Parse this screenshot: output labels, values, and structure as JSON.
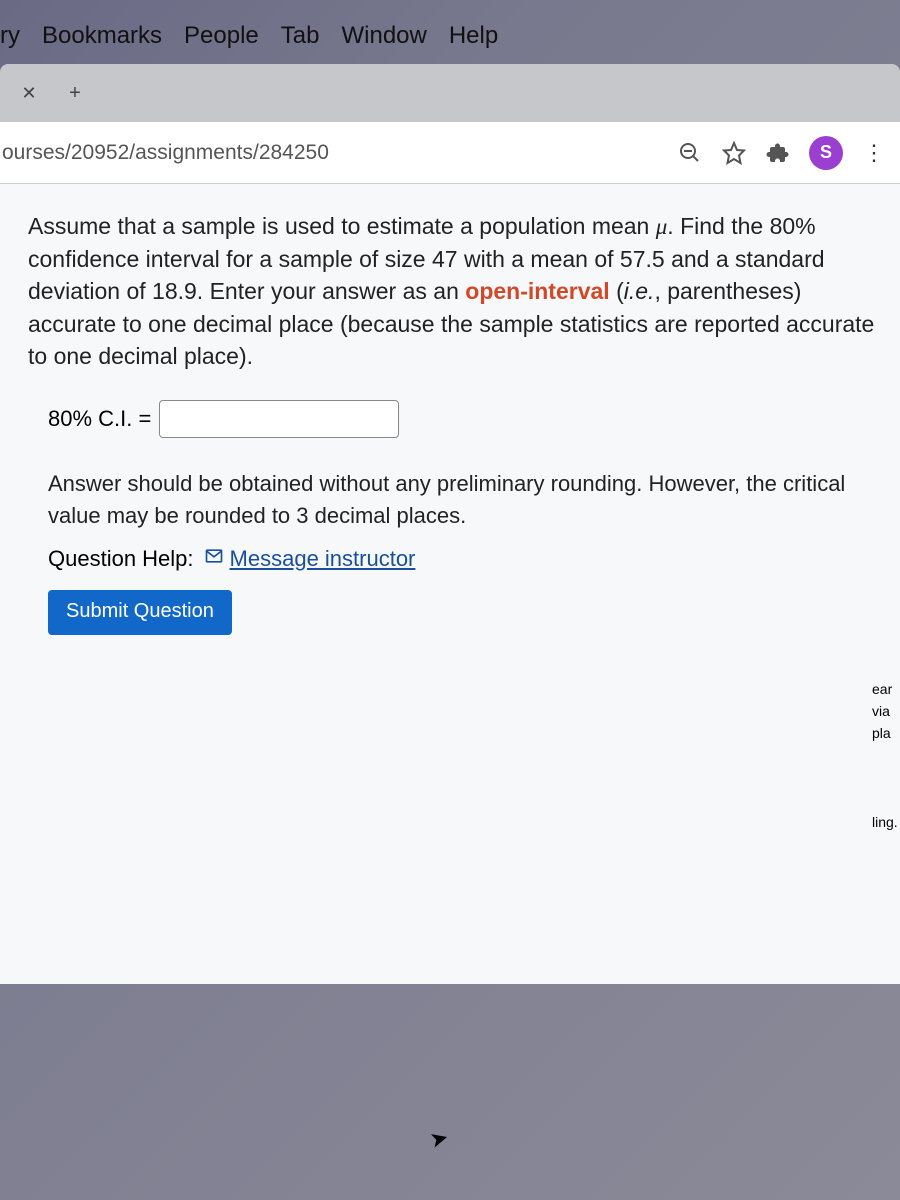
{
  "menubar": {
    "items": [
      "ry",
      "Bookmarks",
      "People",
      "Tab",
      "Window",
      "Help"
    ]
  },
  "tabs": {
    "close_glyph": "✕",
    "add_glyph": "+"
  },
  "address": {
    "url": "ourses/20952/assignments/284250",
    "profile_letter": "S"
  },
  "question": {
    "line1_a": "Assume that a sample is used to estimate a population mean ",
    "mu": "μ",
    "line1_b": ".",
    "line2": "Find the 80% confidence interval for a sample of size 47 with a mean of 57.5 and a standard deviation of 18.9. Enter your answer as an ",
    "open_interval": "open-interval",
    "line3": " (",
    "ie": "i.e.",
    "line4": ", parentheses) accurate to one decimal place (because the sample statistics are reported accurate to one decimal place).",
    "answer_label": "80% C.I. =",
    "answer_value": "",
    "hint1": "Answer should be obtained without any preliminary rounding. However, the critical value may be rounded to 3 decimal places.",
    "help_label": "Question Help:",
    "help_link": "Message instructor",
    "submit": "Submit Question"
  },
  "side": {
    "l1": "ear",
    "l2": "via",
    "l3": "pla",
    "l4": "ling."
  }
}
